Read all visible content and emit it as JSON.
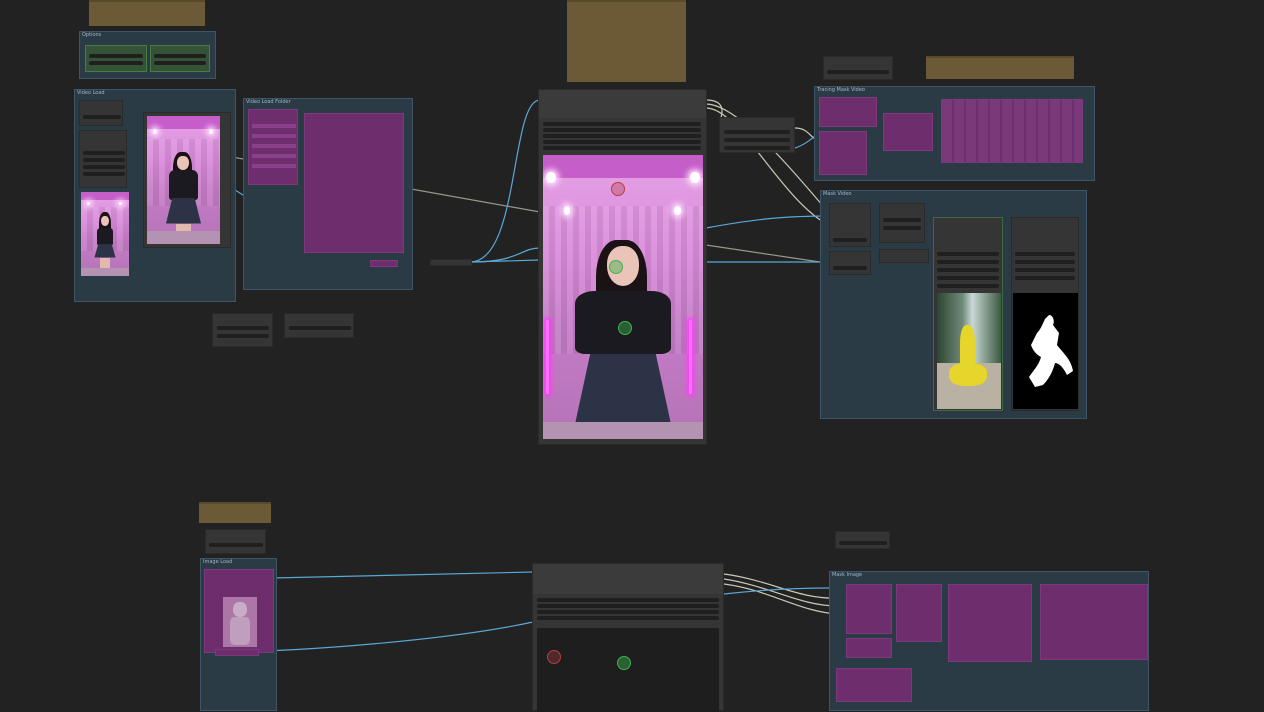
{
  "colors": {
    "canvas": "#222222",
    "group": "#2b3b46",
    "note": "#6b5a35",
    "node": "#353535",
    "bypassed_node": "#6e2e6e",
    "wire": "#5aa8d6",
    "wire_image": "#c9c9b6",
    "point_positive": "#3fb24f",
    "point_negative": "#b23f3f"
  },
  "groups": {
    "options": {
      "title": "Options"
    },
    "video_load": {
      "title": "Video Load"
    },
    "video_load_folder": {
      "title": "Video Load Folder"
    },
    "tracing_mask_video": {
      "title": "Tracing Mask Video"
    },
    "mask_video": {
      "title": "Mask Video"
    },
    "image_load": {
      "title": "Image Load"
    },
    "mask_image": {
      "title": "Mask Image"
    }
  },
  "preview": {
    "points_editor_positive_count": 2,
    "points_editor_negative_count": 1
  },
  "image_points": {
    "positive_count": 1,
    "negative_count": 1
  },
  "icons": {
    "positive_point": "green-circle-point-icon",
    "negative_point": "red-circle-point-icon",
    "slot": "connection-dot-icon"
  }
}
